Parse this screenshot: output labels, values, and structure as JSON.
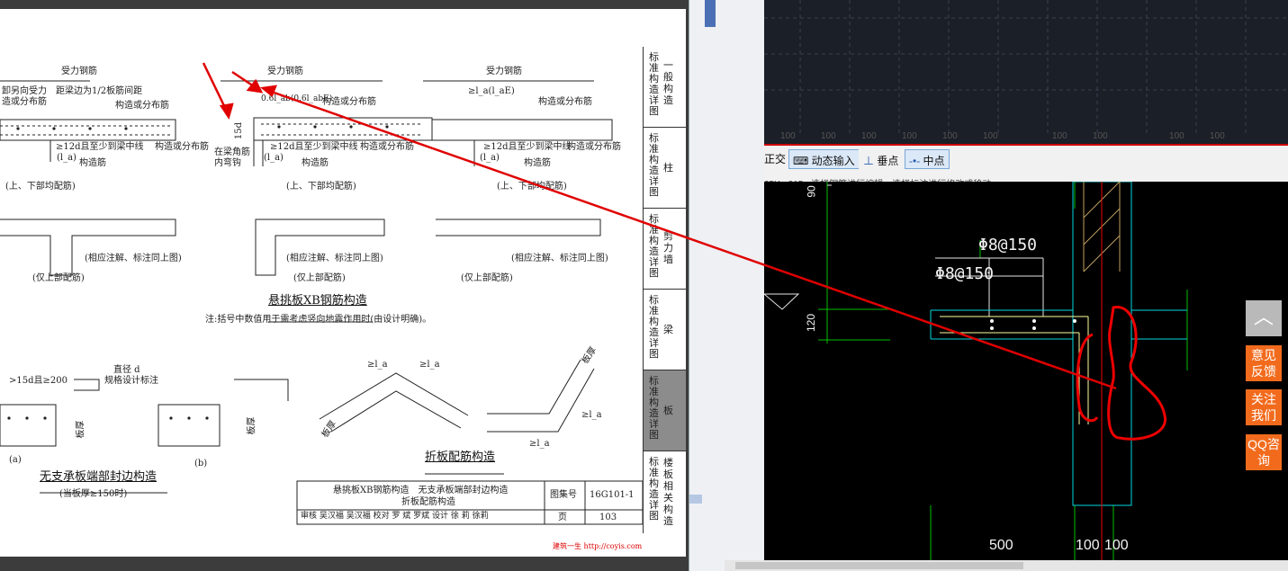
{
  "doc": {
    "top_labels": {
      "rebar_a": "受力钢筋",
      "rebar_b": "受力钢筋",
      "rebar_c": "受力钢筋",
      "left_note_1": "卸另向受力",
      "left_note_2": "造或分布筋",
      "left_spacing": "距梁边为1/2板筋间距",
      "dist_a": "构造或分布筋",
      "dist_b": "构造或分布筋",
      "dist_c": "构造或分布筋",
      "anchor_mid": "0.6l_ab(0.6l_abE)",
      "anchor_right": "≥l_a(l_aE)",
      "sd": "15d",
      "bend_1": "在梁角筋",
      "bend_2": "内弯钩",
      "mid_a": "≥12d且至少到梁中线",
      "mid_b": "≥12d且至少到梁中线",
      "mid_c": "≥12d且至少到梁中线",
      "la_a": "(l_a)",
      "la_b": "(l_a)",
      "la_c": "(l_a)",
      "dist_d": "构造或分布筋",
      "dist_e": "构造或分布筋",
      "dist_f": "构造或分布筋",
      "gz_a": "构造筋",
      "gz_b": "构造筋",
      "gz_c": "构造筋",
      "cap_a": "(上、下部均配筋)",
      "cap_b": "(上、下部均配筋)",
      "cap_c": "(上、下部均配筋)",
      "same_b": "(相应注解、标注同上图)",
      "same_c": "(相应注解、标注同上图)",
      "same_d": "(相应注解、标注同上图)",
      "upper_a": "(仅上部配筋)",
      "upper_b": "(仅上部配筋)",
      "upper_c": "(仅上部配筋)",
      "title_xb": "悬挑板XB钢筋构造",
      "note_xb": "注:括号中数值用于需考虑竖向地震作用时(由设计明确)。",
      "edge_dim": ">15d且≥200",
      "dia_1": "直径 d",
      "dia_2": "规格设计标注",
      "thk_a": "板厚",
      "thk_b": "板厚",
      "thk_c": "板厚",
      "thk_d": "板厚",
      "sub_a": "(a)",
      "sub_b": "(b)",
      "title_edge": "无支承板端部封边构造",
      "title_edge_sub": "(当板厚≥150时)",
      "title_fold": "折板配筋构造",
      "fold_la1": "≥l_a",
      "fold_la2": "≥l_a",
      "fold_la3": "≥l_a",
      "fold_la4": "≥l_a"
    },
    "title_block": {
      "line1": "悬挑板XB钢筋构造　无支承板端部封边构造",
      "line2": "折板配筋构造",
      "atlas_label": "图集号",
      "atlas": "16G101-1",
      "signatures": "审核 吴汉福 吴汉福 校对 罗 斌 罗斌 设计 徐 莉 徐莉",
      "page_label": "页",
      "page": "103"
    },
    "watermark": "建筑一生 http://coyis.com",
    "sidebar": [
      {
        "a": "标准构造详图",
        "b": "一般构造"
      },
      {
        "a": "标准构造详图",
        "b": "柱"
      },
      {
        "a": "标准构造详图",
        "b": "剪力墙"
      },
      {
        "a": "标准构造详图",
        "b": "梁"
      },
      {
        "a": "标准构造详图",
        "b": "板"
      },
      {
        "a": "标准构造详图",
        "b": "楼板相关构造"
      }
    ]
  },
  "cad": {
    "ruler_ticks": [
      "100",
      "100",
      "100",
      "100",
      "100",
      "100",
      "100",
      "100",
      "100",
      "100"
    ],
    "status": {
      "ortho": "正交",
      "dynamic_input": "动态输入",
      "perpendicular": "垂点",
      "midpoint": "中点"
    },
    "hint": "25X - 315 - 选择钢筋进行编辑，选择标注进行修改或移动",
    "labels": {
      "rebar_1": "Φ8@150",
      "rebar_2": "Φ8@150",
      "thickness": "120",
      "top_dim": "90",
      "dim_500": "500",
      "dim_100a": "100",
      "dim_100b": "100"
    }
  },
  "side_buttons": {
    "top": "︿",
    "feedback": "意见反馈",
    "follow": "关注我们",
    "qq": "QQ咨询"
  },
  "colors": {
    "annotation": "#e00000",
    "cad_cyan": "#00d8e0",
    "cad_green": "#00c000",
    "accent": "#f26b1d"
  }
}
